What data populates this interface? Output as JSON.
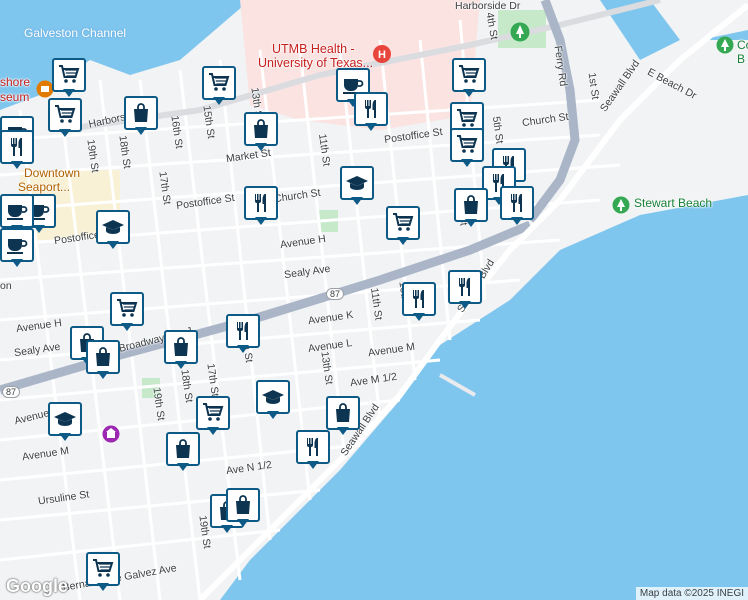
{
  "map": {
    "attribution": "Map data ©2025 INEGI",
    "logo": "Google",
    "water_labels": [
      "Galveston Channel"
    ],
    "poi_labels": [
      {
        "text": "UTMB Health -"
      },
      {
        "text": "University of Texas..."
      },
      {
        "text": "Stewart Beach"
      },
      {
        "text": "Downtown"
      },
      {
        "text": "Seaport..."
      },
      {
        "text": "shore"
      },
      {
        "text": "seum"
      },
      {
        "text": "Co"
      },
      {
        "text": "B"
      }
    ],
    "street_labels": [
      "Harborside Dr",
      "Harborside Dr",
      "4th St",
      "Ferry Rd",
      "1st St",
      "Seawall Blvd",
      "E Beach Dr",
      "Church St",
      "Postoffice St",
      "5th St",
      "Market St",
      "11th St",
      "13th St",
      "15th St",
      "16th St",
      "17th St",
      "18th St",
      "19th St",
      "Postoffice St",
      "Church St",
      "Postoffice",
      "Avenue H",
      "Sealy Ave",
      "Avenue H",
      "Sealy Ave",
      "Broadway Ave J",
      "Avenue K",
      "11th St",
      "10th St",
      "Avenue L",
      "Avenue M",
      "Ave M 1/2",
      "13th St",
      "17th St",
      "18th St",
      "19th St",
      "Avenue K",
      "Avenue M",
      "Ave N 1/2",
      "Ursuline St",
      "19th St",
      "Seawall Blvd",
      "Seawall Blvd",
      "Bernardo De Galvez Ave",
      "14th St",
      "6th St",
      "on"
    ],
    "highway_labels": [
      "87",
      "87"
    ],
    "pins": [
      {
        "kind": "shopping-cart"
      },
      {
        "kind": "coffee"
      },
      {
        "kind": "shopping-cart"
      },
      {
        "kind": "shopping-cart"
      },
      {
        "kind": "shopping-bag"
      },
      {
        "kind": "shopping-cart"
      },
      {
        "kind": "coffee"
      },
      {
        "kind": "restaurant"
      },
      {
        "kind": "shopping-bag"
      },
      {
        "kind": "shopping-cart"
      },
      {
        "kind": "restaurant"
      },
      {
        "kind": "shopping-cart"
      },
      {
        "kind": "restaurant"
      },
      {
        "kind": "restaurant"
      },
      {
        "kind": "school"
      },
      {
        "kind": "restaurant"
      },
      {
        "kind": "shopping-cart"
      },
      {
        "kind": "shopping-bag"
      },
      {
        "kind": "restaurant"
      },
      {
        "kind": "coffee"
      },
      {
        "kind": "coffee"
      },
      {
        "kind": "school"
      },
      {
        "kind": "coffee"
      },
      {
        "kind": "restaurant"
      },
      {
        "kind": "restaurant"
      },
      {
        "kind": "shopping-cart"
      },
      {
        "kind": "shopping-bag"
      },
      {
        "kind": "shopping-bag"
      },
      {
        "kind": "shopping-bag"
      },
      {
        "kind": "restaurant"
      },
      {
        "kind": "school"
      },
      {
        "kind": "school"
      },
      {
        "kind": "shopping-cart"
      },
      {
        "kind": "shopping-bag"
      },
      {
        "kind": "shopping-bag"
      },
      {
        "kind": "restaurant"
      },
      {
        "kind": "shopping-bag"
      },
      {
        "kind": "shopping-cart"
      },
      {
        "kind": "shopping-bag"
      },
      {
        "kind": "shopping-cart"
      }
    ]
  }
}
